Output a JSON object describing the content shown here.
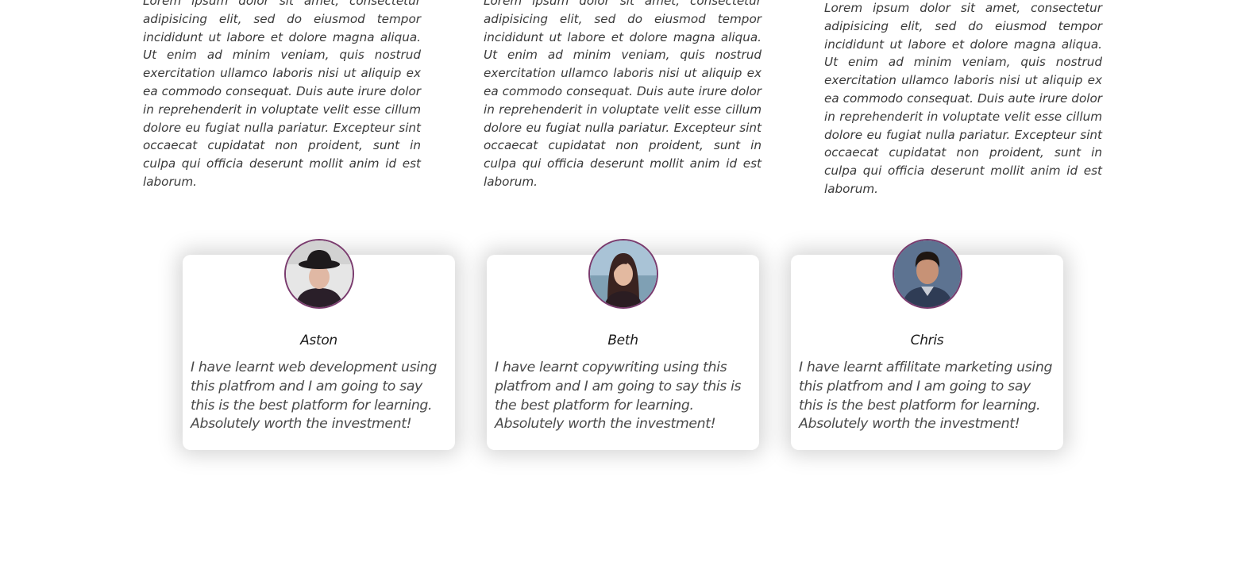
{
  "about": {
    "paragraphs": [
      "Lorem ipsum dolor sit amet, consectetur adipisicing elit, sed do eiusmod tempor incididunt ut labore et dolore magna aliqua. Ut enim ad minim veniam, quis nostrud exercitation ullamco laboris nisi ut aliquip ex ea commodo consequat. Duis aute irure dolor in reprehenderit in voluptate velit esse cillum dolore eu fugiat nulla pariatur. Excepteur sint occaecat cupidatat non proident, sunt in culpa qui officia deserunt mollit anim id est laborum.",
      "Lorem ipsum dolor sit amet, consectetur adipisicing elit, sed do eiusmod tempor incididunt ut labore et dolore magna aliqua. Ut enim ad minim veniam, quis nostrud exercitation ullamco laboris nisi ut aliquip ex ea commodo consequat. Duis aute irure dolor in reprehenderit in voluptate velit esse cillum dolore eu fugiat nulla pariatur. Excepteur sint occaecat cupidatat non proident, sunt in culpa qui officia deserunt mollit anim id est laborum.",
      "Lorem ipsum dolor sit amet, consectetur adipisicing elit, sed do eiusmod tempor incididunt ut labore et dolore magna aliqua. Ut enim ad minim veniam, quis nostrud exercitation ullamco laboris nisi ut aliquip ex ea commodo consequat. Duis aute irure dolor in reprehenderit in voluptate velit esse cillum dolore eu fugiat nulla pariatur. Excepteur sint occaecat cupidatat non proident, sunt in culpa qui officia deserunt mollit anim id est laborum."
    ]
  },
  "testimonials": [
    {
      "name": "Aston",
      "quote": "I have learnt web development using this platfrom and I am going to say this is the best platform for learning. Absolutely worth the investment!",
      "avatar_icon": "person-with-hat-avatar"
    },
    {
      "name": "Beth",
      "quote": "I have learnt copywriting using this platfrom and I am going to say this is the best platform for learning. Absolutely worth the investment!",
      "avatar_icon": "person-long-hair-avatar"
    },
    {
      "name": "Chris",
      "quote": "I have learnt affilitate marketing using this platfrom and I am going to say this is the best platform for learning. Absolutely worth the investment!",
      "avatar_icon": "person-short-hair-avatar"
    }
  ],
  "colors": {
    "avatar_border": "#7a3b6e",
    "card_background": "#ffffff",
    "body_text": "#3a3a3a"
  }
}
